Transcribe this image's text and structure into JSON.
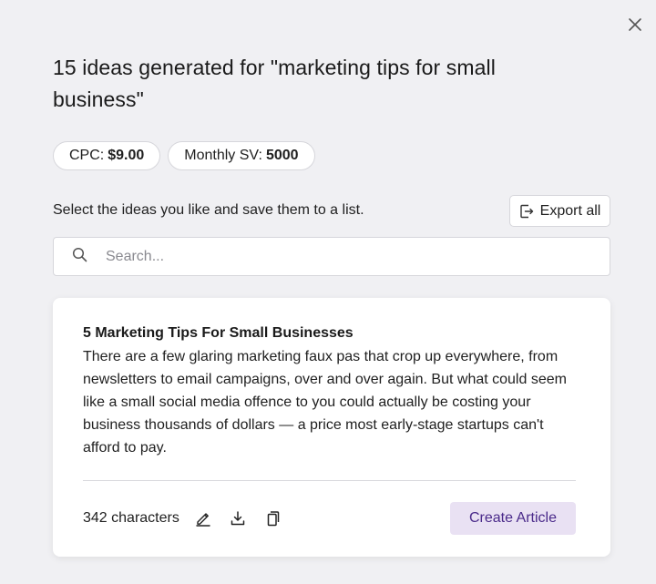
{
  "header": {
    "title": "15 ideas generated for \"marketing tips for small business\""
  },
  "metrics": {
    "cpc_label": "CPC:",
    "cpc_value": "$9.00",
    "sv_label": "Monthly SV:",
    "sv_value": "5000"
  },
  "toolbar": {
    "instruction": "Select the ideas you like and save them to a list.",
    "export_label": "Export all"
  },
  "search": {
    "placeholder": "Search...",
    "value": ""
  },
  "ideas": [
    {
      "title": "5 Marketing Tips For Small Businesses",
      "body": "There are a few glaring marketing faux pas that crop up everywhere, from newsletters to email campaigns, over and over again. But what could seem like a small social media offence to you could actually be costing your business thousands of dollars — a price most early-stage startups can't afford to pay.",
      "char_count": "342 characters",
      "create_label": "Create Article"
    }
  ],
  "icons": {
    "close": "close-icon",
    "export": "export-icon",
    "search": "search-icon",
    "edit": "pencil-icon",
    "download": "download-icon",
    "copy": "copy-icon"
  },
  "colors": {
    "background": "#f0f0f3",
    "card": "#ffffff",
    "accent_button_bg": "#e9e1f3",
    "accent_button_text": "#4a2a8a"
  }
}
